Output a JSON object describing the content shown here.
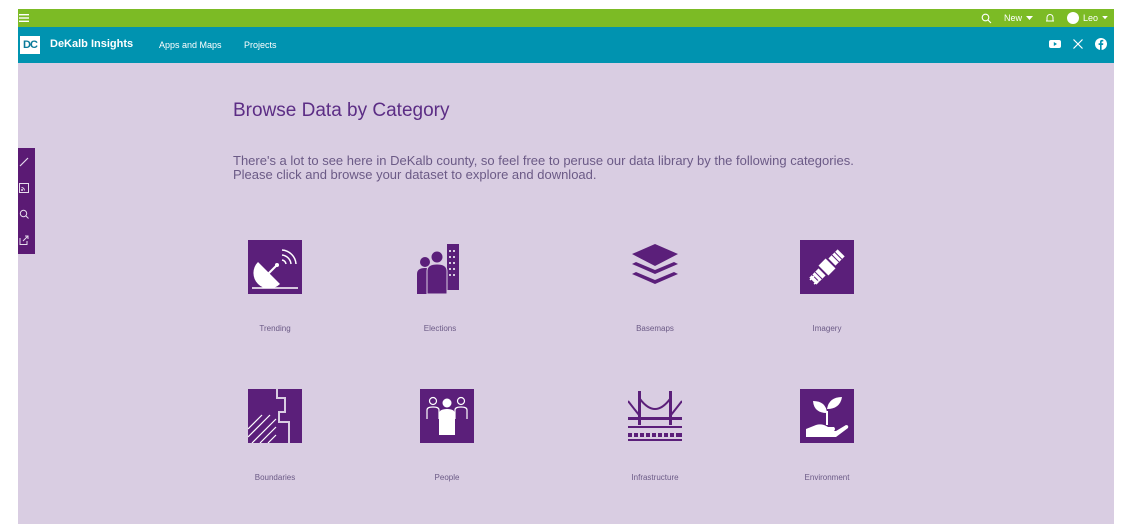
{
  "topbar": {
    "new_label": "New",
    "user_name": "Leo",
    "icons": [
      "hamburger-menu-icon",
      "search-icon",
      "bell-icon",
      "avatar"
    ]
  },
  "navbar": {
    "logo_text": "DC",
    "site_title": "DeKalb Insights",
    "links": [
      "Apps and Maps",
      "Projects"
    ],
    "social_icons": [
      "youtube-icon",
      "x-icon",
      "facebook-icon"
    ]
  },
  "side_rail": {
    "icons": [
      "pencil-icon",
      "rss-icon",
      "reader-icon",
      "share-icon"
    ]
  },
  "main": {
    "title": "Browse Data by Category",
    "intro": "There's a lot to see here in DeKalb county, so feel free to peruse our data library by the following categories. Please click and browse your dataset to explore and download."
  },
  "categories": [
    {
      "label": "Trending",
      "icon": "satellite-dish-icon"
    },
    {
      "label": "Elections",
      "icon": "voters-buildings-icon"
    },
    {
      "label": "Basemaps",
      "icon": "layers-icon"
    },
    {
      "label": "Imagery",
      "icon": "satellite-icon"
    },
    {
      "label": "Boundaries",
      "icon": "boundary-map-icon"
    },
    {
      "label": "People",
      "icon": "people-icon"
    },
    {
      "label": "Infrastructure",
      "icon": "bridge-icon"
    },
    {
      "label": "Environment",
      "icon": "plant-hand-icon"
    }
  ],
  "colors": {
    "topbar": "#7cbb25",
    "navbar": "#0093b0",
    "background": "#d9cde2",
    "accent": "#5b1f7a",
    "title": "#5c2d85"
  }
}
